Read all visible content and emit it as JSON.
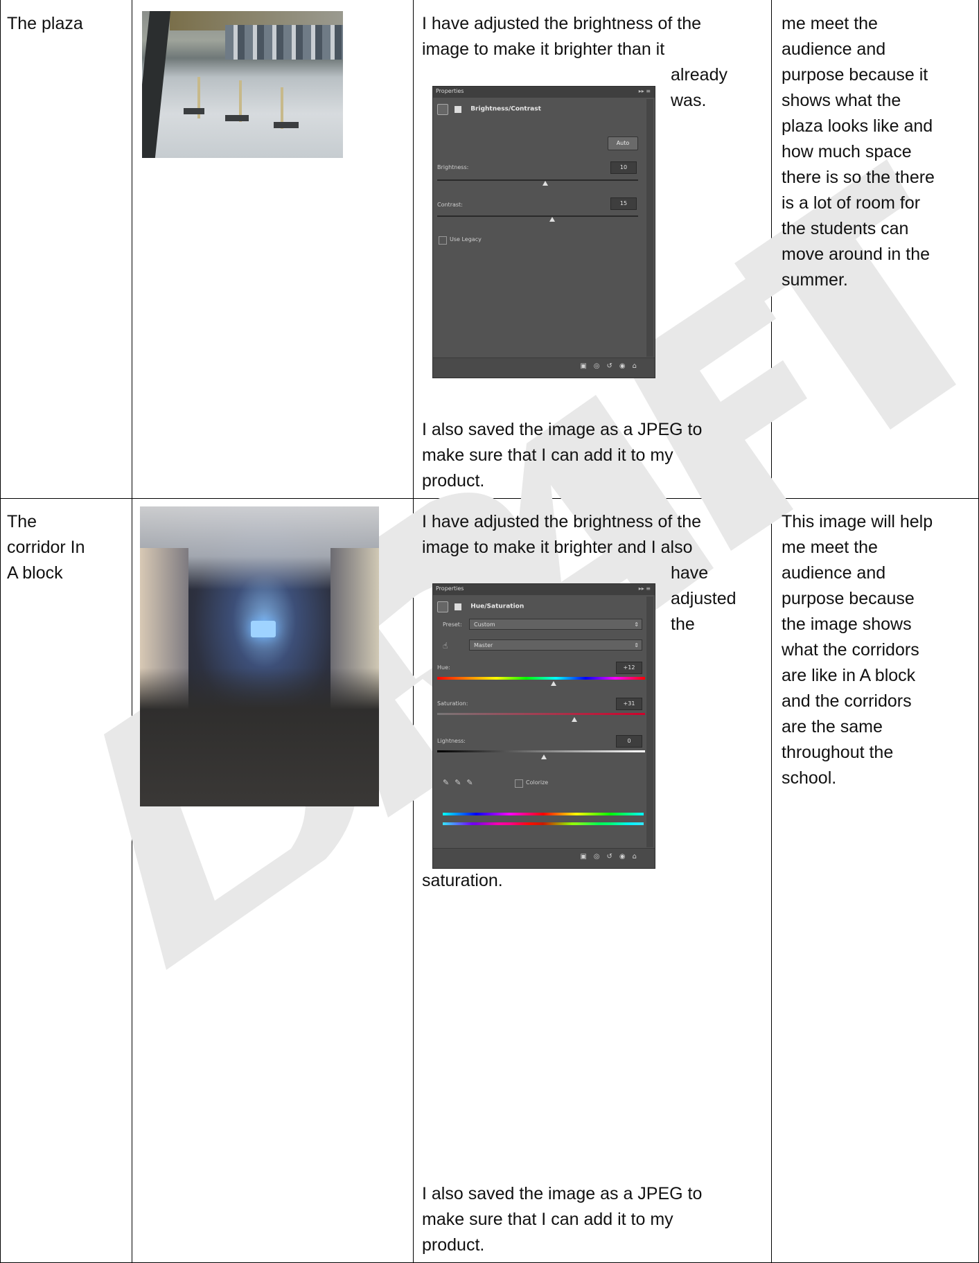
{
  "rows": [
    {
      "label": "The plaza",
      "photo_icon": "plaza-photo",
      "edit_text_top": "I have adjusted the brightness of the\nimage to make it brighter than it",
      "edit_text_wrap": "already\nwas.",
      "edit_text_bottom": "I also saved the image as a JPEG to\nmake sure that I can add it to my\nproduct.",
      "reason": "me meet the\naudience and\npurpose because it\nshows what the\nplaza looks like and\nhow much space\nthere is so the there\nis a lot of room for\nthe students can\nmove around in the\nsummer.",
      "panel": {
        "tab": "Properties",
        "title": "Brightness/Contrast",
        "auto": "Auto",
        "brightness_label": "Brightness:",
        "brightness_value": "10",
        "contrast_label": "Contrast:",
        "contrast_value": "15",
        "legacy_label": "Use Legacy"
      }
    },
    {
      "label": "The\ncorridor In\nA block",
      "photo_icon": "corridor-photo",
      "edit_text_top": "I have adjusted the brightness of the\nimage to make it brighter and I also",
      "edit_text_wrap": "have\nadjusted\nthe",
      "edit_text_after_panel": "saturation.",
      "edit_text_bottom": "I also saved the image as a JPEG to\nmake sure that I can add it to my\nproduct.",
      "reason": "This image will help\nme meet the\naudience and\npurpose because\nthe image shows\nwhat the corridors\nare like in A block\nand the corridors\nare the same\nthroughout the\nschool.",
      "panel": {
        "tab": "Properties",
        "title": "Hue/Saturation",
        "preset_label": "Preset:",
        "preset_value": "Custom",
        "channel_value": "Master",
        "hue_label": "Hue:",
        "hue_value": "+12",
        "saturation_label": "Saturation:",
        "saturation_value": "+31",
        "lightness_label": "Lightness:",
        "lightness_value": "0",
        "colorize_label": "Colorize"
      }
    }
  ],
  "watermark": "DRAFT",
  "colors": {
    "watermark": "#e6e6e6",
    "panel_bg": "#535353",
    "rule": "#000000"
  }
}
